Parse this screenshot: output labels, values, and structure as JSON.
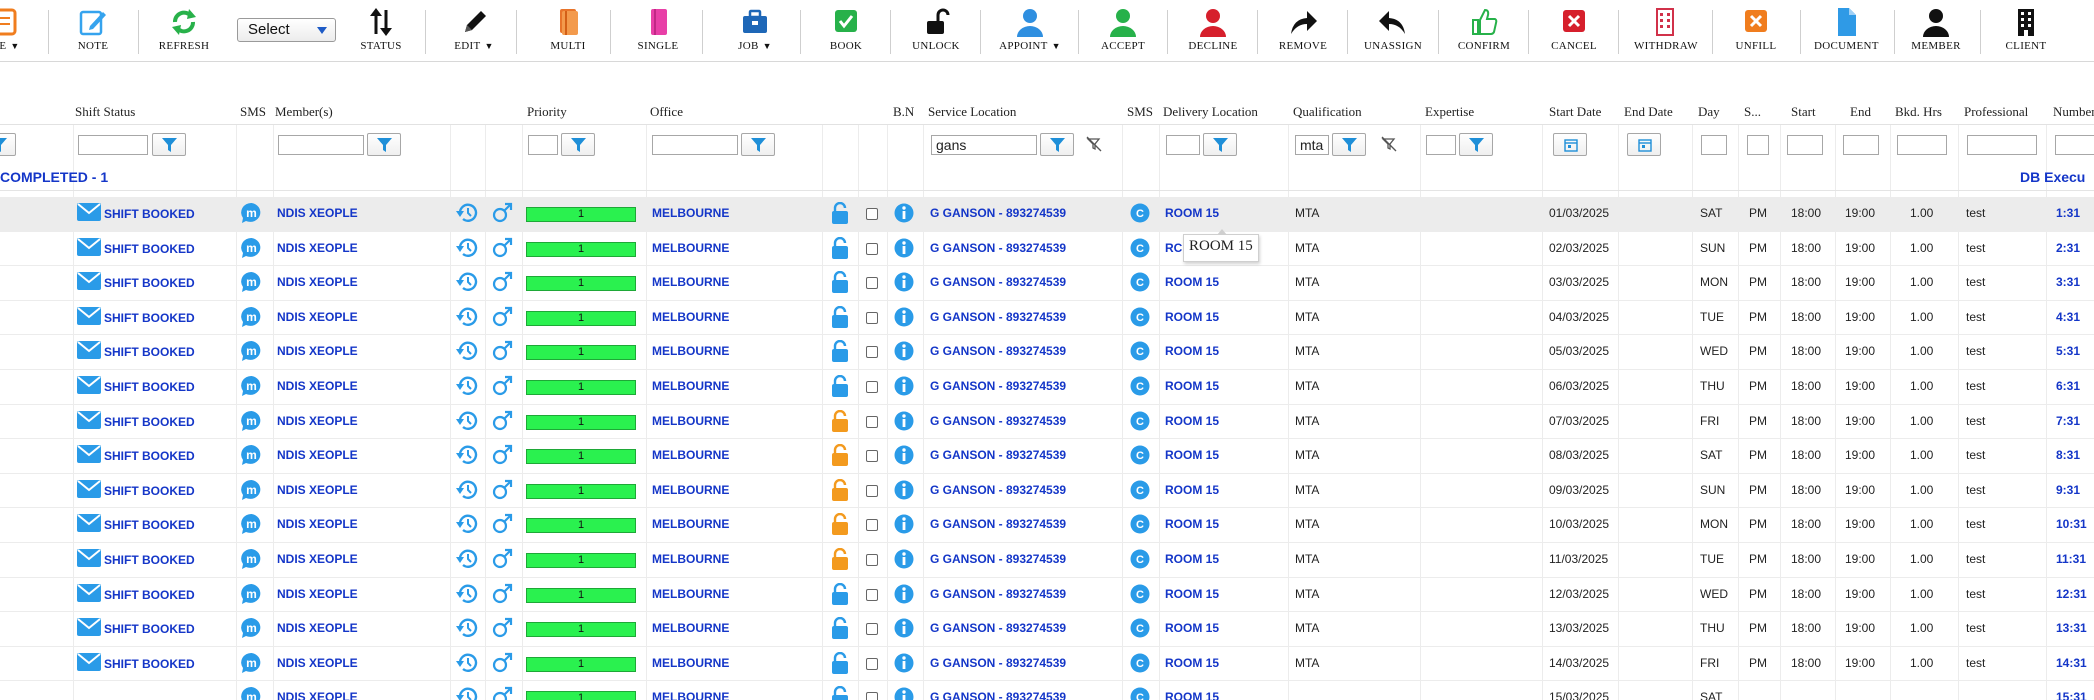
{
  "toolbar": {
    "first_label": "TE",
    "note": "NOTE",
    "refresh": "REFRESH",
    "select_value": "Select",
    "status": "STATUS",
    "edit": "EDIT",
    "multi": "MULTI",
    "single": "SINGLE",
    "job": "JOB",
    "book": "BOOK",
    "unlock": "UNLOCK",
    "appoint": "APPOINT",
    "accept": "ACCEPT",
    "decline": "DECLINE",
    "remove": "REMOVE",
    "unassign": "UNASSIGN",
    "confirm": "CONFIRM",
    "cancel": "CANCEL",
    "withdraw": "WITHDRAW",
    "unfill": "UNFILL",
    "document": "DOCUMENT",
    "member": "MEMBER",
    "client": "CLIENT",
    "caret": "▼"
  },
  "headers": {
    "shift_status": "Shift Status",
    "sms": "SMS",
    "members": "Member(s)",
    "priority": "Priority",
    "office": "Office",
    "bn": "B.N",
    "service_location": "Service Location",
    "sms2": "SMS",
    "delivery_location": "Delivery Location",
    "qualification": "Qualification",
    "expertise": "Expertise",
    "start_date": "Start Date",
    "end_date": "End Date",
    "day": "Day",
    "s": "S...",
    "start": "Start",
    "end": "End",
    "bkd_hrs": "Bkd. Hrs",
    "professional": "Professional",
    "number": "Number"
  },
  "filters": {
    "service_location": "gans",
    "qualification": "mta"
  },
  "group": {
    "label": "COMPLETED - 1",
    "right": "DB Execu"
  },
  "tooltip": "ROOM 15",
  "rows": [
    {
      "status": "SHIFT BOOKED",
      "member": "NDIS XEOPLE",
      "priority": "1",
      "office": "MELBOURNE",
      "lock": "blue",
      "service": "G GANSON - 893274539",
      "delivery": "ROOM 15",
      "qual": "MTA",
      "date": "01/03/2025",
      "day": "SAT",
      "ampm": "PM",
      "start": "18:00",
      "end": "19:00",
      "hrs": "1.00",
      "prof": "test",
      "num": "1:31"
    },
    {
      "status": "SHIFT BOOKED",
      "member": "NDIS XEOPLE",
      "priority": "1",
      "office": "MELBOURNE",
      "lock": "blue",
      "service": "G GANSON - 893274539",
      "delivery": "RC",
      "qual": "MTA",
      "date": "02/03/2025",
      "day": "SUN",
      "ampm": "PM",
      "start": "18:00",
      "end": "19:00",
      "hrs": "1.00",
      "prof": "test",
      "num": "2:31"
    },
    {
      "status": "SHIFT BOOKED",
      "member": "NDIS XEOPLE",
      "priority": "1",
      "office": "MELBOURNE",
      "lock": "blue",
      "service": "G GANSON - 893274539",
      "delivery": "ROOM 15",
      "qual": "MTA",
      "date": "03/03/2025",
      "day": "MON",
      "ampm": "PM",
      "start": "18:00",
      "end": "19:00",
      "hrs": "1.00",
      "prof": "test",
      "num": "3:31"
    },
    {
      "status": "SHIFT BOOKED",
      "member": "NDIS XEOPLE",
      "priority": "1",
      "office": "MELBOURNE",
      "lock": "blue",
      "service": "G GANSON - 893274539",
      "delivery": "ROOM 15",
      "qual": "MTA",
      "date": "04/03/2025",
      "day": "TUE",
      "ampm": "PM",
      "start": "18:00",
      "end": "19:00",
      "hrs": "1.00",
      "prof": "test",
      "num": "4:31"
    },
    {
      "status": "SHIFT BOOKED",
      "member": "NDIS XEOPLE",
      "priority": "1",
      "office": "MELBOURNE",
      "lock": "blue",
      "service": "G GANSON - 893274539",
      "delivery": "ROOM 15",
      "qual": "MTA",
      "date": "05/03/2025",
      "day": "WED",
      "ampm": "PM",
      "start": "18:00",
      "end": "19:00",
      "hrs": "1.00",
      "prof": "test",
      "num": "5:31"
    },
    {
      "status": "SHIFT BOOKED",
      "member": "NDIS XEOPLE",
      "priority": "1",
      "office": "MELBOURNE",
      "lock": "blue",
      "service": "G GANSON - 893274539",
      "delivery": "ROOM 15",
      "qual": "MTA",
      "date": "06/03/2025",
      "day": "THU",
      "ampm": "PM",
      "start": "18:00",
      "end": "19:00",
      "hrs": "1.00",
      "prof": "test",
      "num": "6:31"
    },
    {
      "status": "SHIFT BOOKED",
      "member": "NDIS XEOPLE",
      "priority": "1",
      "office": "MELBOURNE",
      "lock": "orange",
      "service": "G GANSON - 893274539",
      "delivery": "ROOM 15",
      "qual": "MTA",
      "date": "07/03/2025",
      "day": "FRI",
      "ampm": "PM",
      "start": "18:00",
      "end": "19:00",
      "hrs": "1.00",
      "prof": "test",
      "num": "7:31"
    },
    {
      "status": "SHIFT BOOKED",
      "member": "NDIS XEOPLE",
      "priority": "1",
      "office": "MELBOURNE",
      "lock": "orange",
      "service": "G GANSON - 893274539",
      "delivery": "ROOM 15",
      "qual": "MTA",
      "date": "08/03/2025",
      "day": "SAT",
      "ampm": "PM",
      "start": "18:00",
      "end": "19:00",
      "hrs": "1.00",
      "prof": "test",
      "num": "8:31"
    },
    {
      "status": "SHIFT BOOKED",
      "member": "NDIS XEOPLE",
      "priority": "1",
      "office": "MELBOURNE",
      "lock": "orange",
      "service": "G GANSON - 893274539",
      "delivery": "ROOM 15",
      "qual": "MTA",
      "date": "09/03/2025",
      "day": "SUN",
      "ampm": "PM",
      "start": "18:00",
      "end": "19:00",
      "hrs": "1.00",
      "prof": "test",
      "num": "9:31"
    },
    {
      "status": "SHIFT BOOKED",
      "member": "NDIS XEOPLE",
      "priority": "1",
      "office": "MELBOURNE",
      "lock": "orange",
      "service": "G GANSON - 893274539",
      "delivery": "ROOM 15",
      "qual": "MTA",
      "date": "10/03/2025",
      "day": "MON",
      "ampm": "PM",
      "start": "18:00",
      "end": "19:00",
      "hrs": "1.00",
      "prof": "test",
      "num": "10:31"
    },
    {
      "status": "SHIFT BOOKED",
      "member": "NDIS XEOPLE",
      "priority": "1",
      "office": "MELBOURNE",
      "lock": "orange",
      "service": "G GANSON - 893274539",
      "delivery": "ROOM 15",
      "qual": "MTA",
      "date": "11/03/2025",
      "day": "TUE",
      "ampm": "PM",
      "start": "18:00",
      "end": "19:00",
      "hrs": "1.00",
      "prof": "test",
      "num": "11:31"
    },
    {
      "status": "SHIFT BOOKED",
      "member": "NDIS XEOPLE",
      "priority": "1",
      "office": "MELBOURNE",
      "lock": "blue",
      "service": "G GANSON - 893274539",
      "delivery": "ROOM 15",
      "qual": "MTA",
      "date": "12/03/2025",
      "day": "WED",
      "ampm": "PM",
      "start": "18:00",
      "end": "19:00",
      "hrs": "1.00",
      "prof": "test",
      "num": "12:31"
    },
    {
      "status": "SHIFT BOOKED",
      "member": "NDIS XEOPLE",
      "priority": "1",
      "office": "MELBOURNE",
      "lock": "blue",
      "service": "G GANSON - 893274539",
      "delivery": "ROOM 15",
      "qual": "MTA",
      "date": "13/03/2025",
      "day": "THU",
      "ampm": "PM",
      "start": "18:00",
      "end": "19:00",
      "hrs": "1.00",
      "prof": "test",
      "num": "13:31"
    },
    {
      "status": "SHIFT BOOKED",
      "member": "NDIS XEOPLE",
      "priority": "1",
      "office": "MELBOURNE",
      "lock": "blue",
      "service": "G GANSON - 893274539",
      "delivery": "ROOM 15",
      "qual": "MTA",
      "date": "14/03/2025",
      "day": "FRI",
      "ampm": "PM",
      "start": "18:00",
      "end": "19:00",
      "hrs": "1.00",
      "prof": "test",
      "num": "14:31"
    },
    {
      "status": "",
      "member": "NDIS XEOPLE",
      "priority": "1",
      "office": "MELBOURNE",
      "lock": "blue",
      "service": "G GANSON - 893274539",
      "delivery": "ROOM 15",
      "qual": "",
      "date": "15/03/2025",
      "day": "SAT",
      "ampm": "",
      "start": "",
      "end": "",
      "hrs": "",
      "prof": "",
      "num": "15:31"
    }
  ],
  "colors": {
    "link_blue": "#1436c8",
    "priority_green": "#2af14f",
    "lock_blue": "#2a9be8",
    "lock_orange": "#f39a1e"
  }
}
